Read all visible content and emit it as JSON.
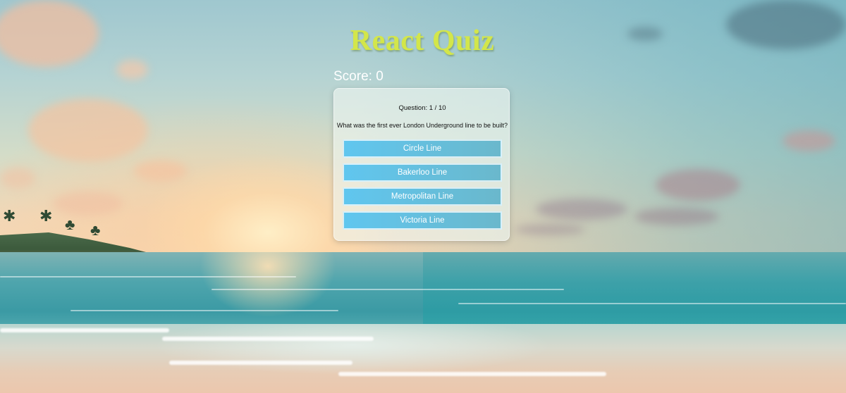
{
  "app": {
    "title": "React Quiz",
    "score_text": "Score: 0"
  },
  "quiz": {
    "question_counter": "Question: 1 / 10",
    "question": "What was the first ever London Underground line to be built?",
    "answers": [
      {
        "label": "Circle Line"
      },
      {
        "label": "Bakerloo Line"
      },
      {
        "label": "Metropolitan Line"
      },
      {
        "label": "Victoria Line"
      }
    ]
  },
  "colors": {
    "title": "#d3e64a",
    "score": "#ffffff",
    "answer_gradient_start": "#60c6ef",
    "answer_gradient_end": "#6ab8cc"
  },
  "background": {
    "scene": "beach-sunset-photo"
  }
}
